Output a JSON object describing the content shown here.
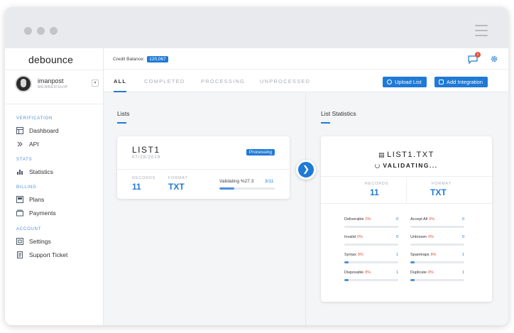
{
  "app": {
    "logo": "debounce"
  },
  "user": {
    "name": "imanpost",
    "role": "MEMBERSHIP"
  },
  "sidebar": {
    "sections": [
      "VERIFICATION",
      "STATS",
      "BILLING",
      "ACCOUNT"
    ],
    "items": [
      {
        "label": "Dashboard",
        "icon": "dashboard-icon"
      },
      {
        "label": "API",
        "icon": "api-icon"
      },
      {
        "label": "Statistics",
        "icon": "statistics-icon"
      },
      {
        "label": "Plans",
        "icon": "plans-icon"
      },
      {
        "label": "Payments",
        "icon": "payments-icon"
      },
      {
        "label": "Settings",
        "icon": "settings-icon"
      },
      {
        "label": "Support Ticket",
        "icon": "support-ticket-icon"
      }
    ]
  },
  "topbar": {
    "credit_label": "Credit Balance:",
    "credit_value": "120,067",
    "notif_count": "1"
  },
  "tabs": [
    "ALL",
    "COMPLETED",
    "PROCESSING",
    "UNPROCESSED"
  ],
  "buttons": {
    "upload": "Upload List",
    "integration": "Add Integration"
  },
  "lists": {
    "title": "Lists",
    "card": {
      "name": "LIST1",
      "date": "07/28/2019",
      "status": "Processing",
      "records_label": "RECORDS",
      "records": "11",
      "format_label": "FORMAT",
      "format": "TXT",
      "validating_label": "Validating %27.3",
      "validating_count": "3/11",
      "progress": 0.27
    }
  },
  "stats": {
    "title": "List Statistics",
    "file": "LIST1.TXT",
    "status": "VALIDATING...",
    "records_label": "RECORDS",
    "records": "11",
    "format_label": "FORMAT",
    "format": "TXT",
    "rows": [
      {
        "name": "Deliverable",
        "pct": "0%",
        "count": "0",
        "fill": 0
      },
      {
        "name": "Accept All",
        "pct": "0%",
        "count": "0",
        "fill": 0
      },
      {
        "name": "Invalid",
        "pct": "0%",
        "count": "0",
        "fill": 0
      },
      {
        "name": "Unknown",
        "pct": "0%",
        "count": "0",
        "fill": 0
      },
      {
        "name": "Syntax",
        "pct": "8%",
        "count": "1",
        "fill": 0.08
      },
      {
        "name": "Spamtraps",
        "pct": "8%",
        "count": "1",
        "fill": 0.08
      },
      {
        "name": "Disposable",
        "pct": "8%",
        "count": "1",
        "fill": 0.08
      },
      {
        "name": "Duplicate",
        "pct": "8%",
        "count": "1",
        "fill": 0.08
      }
    ]
  },
  "colors": {
    "accent": "#1f7ad6",
    "danger": "#e0533f"
  }
}
